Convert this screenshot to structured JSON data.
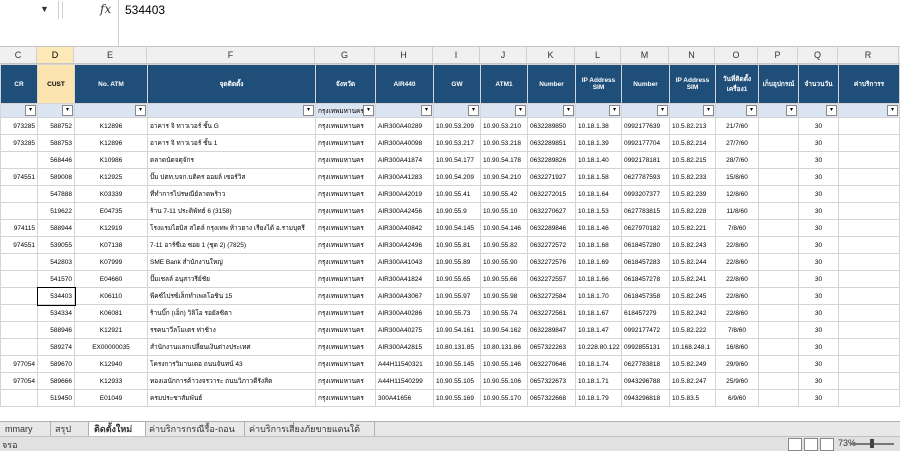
{
  "formula_bar": {
    "name_box": "",
    "fx": "fx",
    "value": "534403"
  },
  "column_letters": [
    "C",
    "D",
    "E",
    "F",
    "G",
    "H",
    "I",
    "J",
    "K",
    "L",
    "M",
    "N",
    "O",
    "P",
    "Q",
    "R"
  ],
  "headers": [
    "CR",
    "CUST",
    "No. ATM",
    "จุดติดตั้ง",
    "จังหวัด",
    "AIR440",
    "GW",
    "ATM1",
    "Number",
    "IP Address SIM",
    "Number",
    "IP Address SIM",
    "วันที่ติดตั้ง เครื่อง1",
    "เก็บอุปกรณ์",
    "จำนวนวัน",
    "ค่าบริการร"
  ],
  "filter_province": "กรุงเทพมหานคร",
  "rows": [
    [
      "973285",
      "588752",
      "K12896",
      "อาคาร จิ ทาวเวอร์ ชั้น G",
      "กรุงเทพมหานคร",
      "AIR300A40289",
      "10.90.53.209",
      "10.90.53.210",
      "0632289850",
      "10.18.1.38",
      "0992177639",
      "10.5.82.213",
      "21/7/60",
      "",
      "30"
    ],
    [
      "973285",
      "588753",
      "K12896",
      "อาคาร จิ ทาวเวอร์ ชั้น 1",
      "กรุงเทพมหานคร",
      "AIR300A40098",
      "10.90.53.217",
      "10.90.53.218",
      "0632289851",
      "10.18.1.39",
      "0992177704",
      "10.5.82.214",
      "27/7/60",
      "",
      "30"
    ],
    [
      "",
      "568446",
      "K10986",
      "ตลาดนัดจตุจักร",
      "กรุงเทพมหานคร",
      "AIR300A41874",
      "10.90.54.177",
      "10.90.54.178",
      "0632289826",
      "10.18.1.40",
      "0992178181",
      "10.5.82.215",
      "28/7/60",
      "",
      "30"
    ],
    [
      "974551",
      "589008",
      "K12925",
      "ปั๊ม ปตท.บจก.บติคร ออยล์ เซอร์วิส",
      "กรุงเทพมหานคร",
      "AIR300A41283",
      "10.90.54.209",
      "10.90.54.210",
      "0632271927",
      "10.18.1.58",
      "0627787593",
      "10.5.82.233",
      "15/8/60",
      "",
      "30"
    ],
    [
      "",
      "547888",
      "K03339",
      "ที่ทำการไปรษณีย์ลาดพร้าว",
      "กรุงเทพมหานคร",
      "AIR300A42019",
      "10.90.55.41",
      "10.90.55.42",
      "0632272015",
      "10.18.1.64",
      "0993207377",
      "10.5.82.239",
      "12/8/60",
      "",
      "30"
    ],
    [
      "",
      "519622",
      "E04735",
      "ร้าน 7-11 ประดิพัทธ์ 6 (3158)",
      "กรุงเทพมหานคร",
      "AIR300A42456",
      "10.90.55.9",
      "10.90.55.10",
      "0632270627",
      "10.18.1.53",
      "0627783815",
      "10.5.82.228",
      "11/8/60",
      "",
      "30"
    ],
    [
      "974115",
      "588944",
      "K12919",
      "โรงแรมไฮบิส สไตล์ กรุงเทพ ห้าวฮาง เรียงได้ อ.รามบุตรี",
      "กรุงเทพมหานคร",
      "AIR300A40842",
      "10.90.54.145",
      "10.90.54.146",
      "0632289846",
      "10.18.1.46",
      "0627970182",
      "10.5.82.221",
      "7/8/60",
      "",
      "30"
    ],
    [
      "974551",
      "539055",
      "K07138",
      "7-11 อาร์ซีเอ ซอย 1 (ชุด 2) (7825)",
      "กรุงเทพมหานคร",
      "AIR300A42496",
      "10.90.55.81",
      "10.90.55.82",
      "0632272572",
      "10.18.1.68",
      "0618457280",
      "10.5.82.243",
      "22/8/60",
      "",
      "30"
    ],
    [
      "",
      "542803",
      "K07999",
      "SME Bank สำนักงานใหญ่",
      "กรุงเทพมหานคร",
      "AIR300A41043",
      "10.90.55.89",
      "10.90.55.90",
      "0632272576",
      "10.18.1.69",
      "0618457283",
      "10.5.82.244",
      "22/8/60",
      "",
      "30"
    ],
    [
      "",
      "541570",
      "E04660",
      "ปั๊มเชลล์ อนุสาวรีย์ชัย",
      "กรุงเทพมหานคร",
      "AIR300A41824",
      "10.90.55.65",
      "10.90.55.66",
      "0632272557",
      "10.18.1.66",
      "0618457278",
      "10.5.82.241",
      "22/8/60",
      "",
      "30"
    ],
    [
      "",
      "534403",
      "K06110",
      "พีคซ์ไปรซ์เล็กทำเพลโอชิน 15",
      "กรุงเทพมหานคร",
      "AIR300A43067",
      "10.90.55.97",
      "10.90.55.98",
      "0632272584",
      "10.18.1.70",
      "0618457358",
      "10.5.82.245",
      "22/8/60",
      "",
      "30"
    ],
    [
      "",
      "534334",
      "K06081",
      "ร้านบิ๊ก (เอ็ก) วิลิโอ รอยัลซิตา",
      "กรุงเทพมหานคร",
      "AIR300A40286",
      "10.90.55.73",
      "10.90.55.74",
      "0632272561",
      "10.18.1.67",
      "618457279",
      "10.5.82.242",
      "22/8/60",
      "",
      "30"
    ],
    [
      "",
      "588946",
      "K12921",
      "รรคนาวีลโมเตร ท่าช้าง",
      "กรุงเทพมหานคร",
      "AIR300A40275",
      "10.90.54.161",
      "10.90.54.162",
      "0632289847",
      "10.18.1.47",
      "0992177472",
      "10.5.82.222",
      "7/8/60",
      "",
      "30"
    ],
    [
      "",
      "589274",
      "EX00000035",
      "สำนักงานแลกเปลี่ยนเงินต่างประเทศ",
      "กรุงเทพมหานคร",
      "AIR300A42815",
      "10.80.131.85",
      "10.80.131.86",
      "0657322263",
      "10.228.80.122",
      "0992855131",
      "10.168.248.1",
      "16/8/60",
      "",
      "30"
    ],
    [
      "977054",
      "589670",
      "K12940",
      "โครงการวิมานเตอ ถนนจันทน์ 43",
      "กรุงเทพมหานคร",
      "A44H11540321",
      "10.90.55.145",
      "10.90.55.146",
      "0632270646",
      "10.18.1.74",
      "0627783818",
      "10.5.82.249",
      "29/9/60",
      "",
      "30"
    ],
    [
      "977054",
      "589666",
      "K12933",
      "ทองเอนักการค้าวงจรวาระ ถนนวิภาวดีรังสิต",
      "กรุงเทพมหานคร",
      "A44H11540299",
      "10.90.55.105",
      "10.90.55.106",
      "0657322673",
      "10.18.1.71",
      "0943296788",
      "10.5.82.247",
      "25/9/60",
      "",
      "30"
    ],
    [
      "",
      "519450",
      "E01049",
      "ครมประชาสัมพันธ์",
      "กรุงเทพมหานคร",
      "300A41656",
      "10.90.55.169",
      "10.90.55.170",
      "0657322668",
      "10.18.1.79",
      "0943296818",
      "10.5.83.5",
      "6/9/60",
      "",
      "30"
    ]
  ],
  "sheet_tabs": [
    "mmary",
    "สรุป",
    "ติดตั้งใหม่",
    "ค่าบริการกรณีรื้อ-ถอน",
    "ค่าบริการเสี่ยงภัยขายแดนใต้"
  ],
  "status": {
    "left": "จรอ",
    "zoom": "73%"
  }
}
